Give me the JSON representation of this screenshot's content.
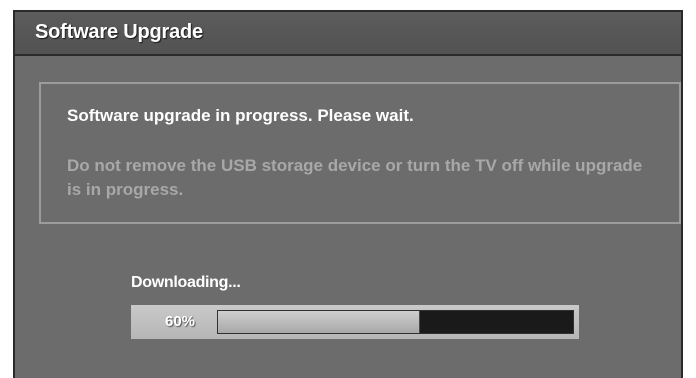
{
  "window": {
    "title": "Software Upgrade"
  },
  "message": {
    "main": "Software upgrade in progress. Please wait.",
    "warning": "Do not remove the USB storage device or turn the TV off while upgrade is in progress."
  },
  "progress": {
    "status": "Downloading...",
    "percent_label": "60%",
    "fraction": 0.57
  },
  "colors": {
    "panel": "#6c6c6c",
    "titlebar": "#525252",
    "text": "#ffffff",
    "warning_text": "#a8a8a8",
    "track": "#1a1a1a"
  }
}
